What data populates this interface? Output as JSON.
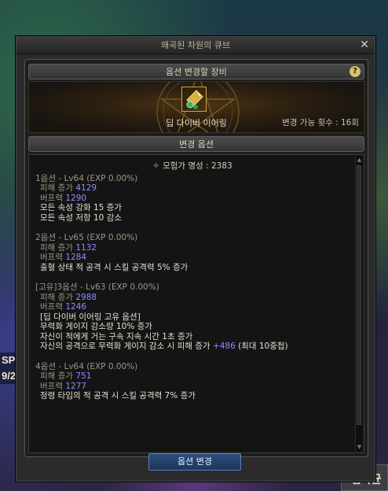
{
  "window": {
    "title": "왜곡된 차원의 큐브"
  },
  "equip_section": {
    "header": "옵션 변경할 장비",
    "item_name": "딥 다이버 이어링",
    "change_count_label": "변경 가능 횟수 : 16회"
  },
  "options_section": {
    "header": "변경 옵션",
    "renown": "모험가 명성 : 2383",
    "blocks": [
      {
        "title": "1옵션 - Lv64 (EXP 0.00%)",
        "lines": [
          {
            "text": "피해 증가 ",
            "value": "4129"
          },
          {
            "text": "버프력 ",
            "value": "1290"
          },
          {
            "text": "모든 속성 강화 15 증가",
            "value": ""
          },
          {
            "text": "모든 속성 저항 10 감소",
            "value": ""
          }
        ]
      },
      {
        "title": "2옵션 - Lv65 (EXP 0.00%)",
        "lines": [
          {
            "text": "피해 증가 ",
            "value": "1132"
          },
          {
            "text": "버프력 ",
            "value": "1284"
          },
          {
            "text": "출혈 상태 적 공격 시 스킬 공격력 5% 증가",
            "value": ""
          }
        ]
      },
      {
        "title": "[고유]3옵션 - Lv63 (EXP 0.00%)",
        "lines": [
          {
            "text": "피해 증가 ",
            "value": "2988"
          },
          {
            "text": "버프력 ",
            "value": "1246"
          },
          {
            "text": "[딥 다이버 이어링 고유 옵션]",
            "value": ""
          },
          {
            "text": "무력화 게이지 감소량 10% 증가",
            "value": ""
          },
          {
            "text": "자신이 적에게 거는 구속 지속 시간 1초 증가",
            "value": ""
          },
          {
            "text": "자신의 공격으로 무력화 게이지 감소 시 피해 증가 ",
            "value": "+486",
            "suffix": " (최대 10중첩)"
          }
        ]
      },
      {
        "title": "4옵션 - Lv64 (EXP 0.00%)",
        "lines": [
          {
            "text": "피해 증가 ",
            "value": "751"
          },
          {
            "text": "버프력 ",
            "value": "1277"
          },
          {
            "text": "정령 타입의 적 공격 시 스킬 공격력 7% 증가",
            "value": ""
          }
        ]
      }
    ]
  },
  "buttons": {
    "apply": "옵션 변경"
  },
  "background": {
    "left_text": "SPE",
    "left_text2": "9/2",
    "right_text": "검학균"
  },
  "colors": {
    "value_color": "#8c8cff",
    "button_blue": "#2d4f7d"
  }
}
